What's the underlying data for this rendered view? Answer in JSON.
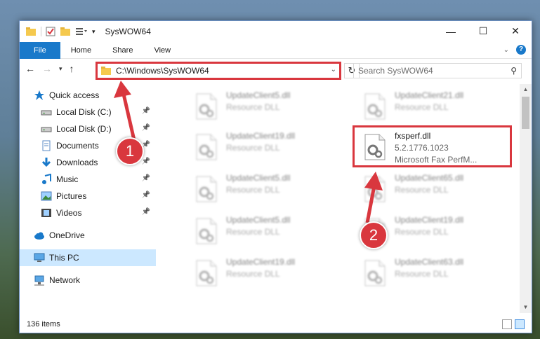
{
  "window": {
    "title": "SysWOW64",
    "controls": {
      "minimize": "—",
      "maximize": "☐",
      "close": "✕"
    }
  },
  "ribbon": {
    "tabs": [
      "File",
      "Home",
      "Share",
      "View"
    ]
  },
  "nav": {
    "address": "C:\\Windows\\SysWOW64",
    "search_placeholder": "Search SysWOW64"
  },
  "sidebar": {
    "items": [
      {
        "label": "Quick access",
        "icon": "star-icon"
      },
      {
        "label": "Local Disk (C:)",
        "icon": "drive-icon",
        "pinned": true
      },
      {
        "label": "Local Disk (D:)",
        "icon": "drive-icon",
        "pinned": true
      },
      {
        "label": "Documents",
        "icon": "document-icon",
        "pinned": true
      },
      {
        "label": "Downloads",
        "icon": "download-icon",
        "pinned": true
      },
      {
        "label": "Music",
        "icon": "music-icon",
        "pinned": true
      },
      {
        "label": "Pictures",
        "icon": "pictures-icon",
        "pinned": true
      },
      {
        "label": "Videos",
        "icon": "video-icon",
        "pinned": true
      },
      {
        "label": "OneDrive",
        "icon": "cloud-icon"
      },
      {
        "label": "This PC",
        "icon": "pc-icon",
        "selected": true
      },
      {
        "label": "Network",
        "icon": "network-icon"
      }
    ]
  },
  "files": {
    "left": [
      {
        "name": "UpdateClient5.dll",
        "type": "Resource DLL"
      },
      {
        "name": "UpdateClient19.dll",
        "type": "Resource DLL"
      },
      {
        "name": "UpdateClient5.dll",
        "type": "Resource DLL"
      },
      {
        "name": "UpdateClient5.dll",
        "type": "Resource DLL"
      },
      {
        "name": "UpdateClient19.dll",
        "type": "Resource DLL"
      }
    ],
    "right": [
      {
        "name": "UpdateClient21.dll",
        "type": "Resource DLL"
      },
      {
        "name": "fxsperf.dll",
        "version": "5.2.1776.1023",
        "type": "Microsoft Fax PerfM..."
      },
      {
        "name": "UpdateClient65.dll",
        "type": "Resource DLL"
      },
      {
        "name": "UpdateClient19.dll",
        "type": "Resource DLL"
      },
      {
        "name": "UpdateClient63.dll",
        "type": "Resource DLL"
      }
    ]
  },
  "status": {
    "item_count": "136 items"
  },
  "callouts": [
    "1",
    "2"
  ],
  "colors": {
    "accent": "#1979ca",
    "highlight": "#d9373e",
    "selected": "#cce8ff"
  }
}
